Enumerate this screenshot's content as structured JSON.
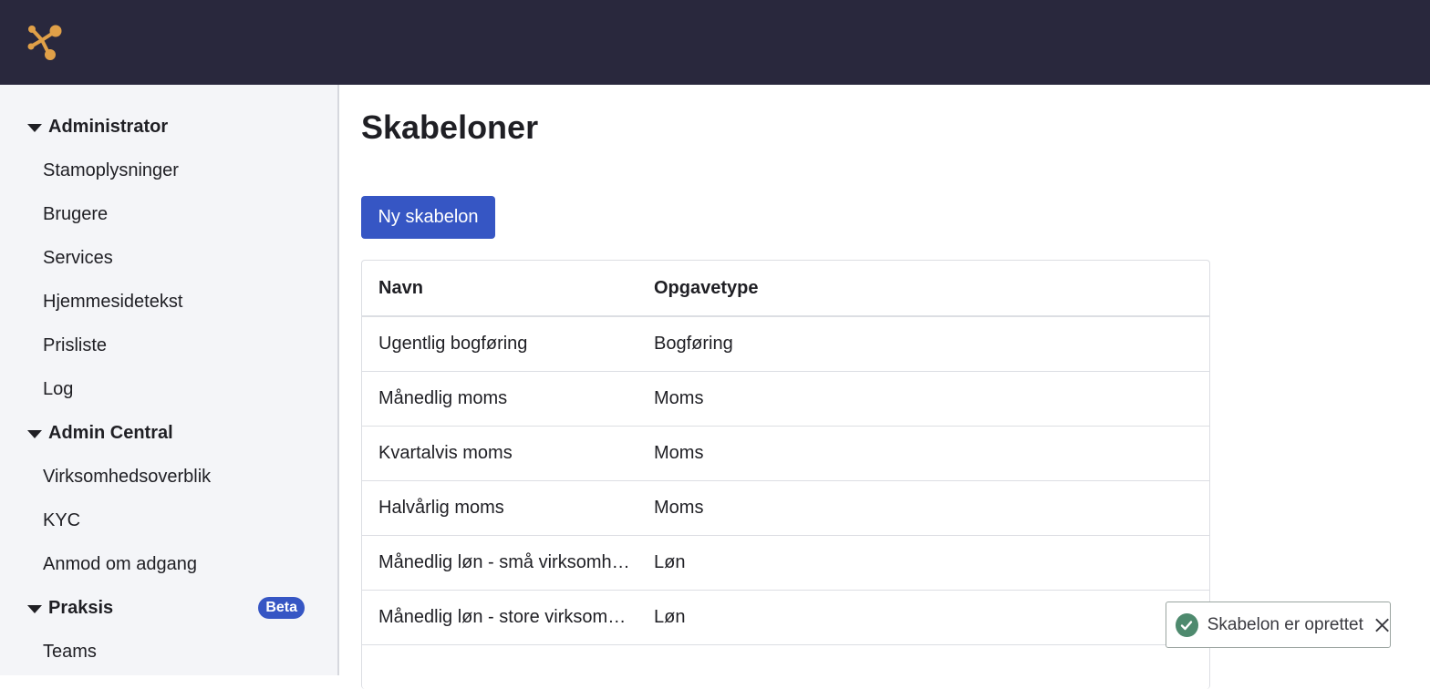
{
  "header": {
    "logo_icon": "brand-logo-icon"
  },
  "sidebar": {
    "sections": [
      {
        "label": "Administrator",
        "items": [
          "Stamoplysninger",
          "Brugere",
          "Services",
          "Hjemmesidetekst",
          "Prisliste",
          "Log"
        ]
      },
      {
        "label": "Admin Central",
        "items": [
          "Virksomhedsoverblik",
          "KYC",
          "Anmod om adgang"
        ]
      },
      {
        "label": "Praksis",
        "badge": "Beta",
        "items": [
          "Teams"
        ]
      }
    ]
  },
  "main": {
    "title": "Skabeloner",
    "new_button": "Ny skabelon",
    "table": {
      "headers": [
        "Navn",
        "Opgavetype"
      ],
      "rows": [
        [
          "Ugentlig bogføring",
          "Bogføring"
        ],
        [
          "Månedlig moms",
          "Moms"
        ],
        [
          "Kvartalvis moms",
          "Moms"
        ],
        [
          "Halvårlig moms",
          "Moms"
        ],
        [
          "Månedlig løn - små virksomheder",
          "Løn"
        ],
        [
          "Månedlig løn - store virksomheder",
          "Løn"
        ]
      ]
    }
  },
  "toast": {
    "message": "Skabelon er oprettet",
    "icon": "check-circle-icon",
    "close_icon": "close-icon"
  },
  "colors": {
    "topbar": "#29283d",
    "accent": "#3656c4",
    "logo": "#e0a048",
    "success": "#4e8a6e"
  }
}
